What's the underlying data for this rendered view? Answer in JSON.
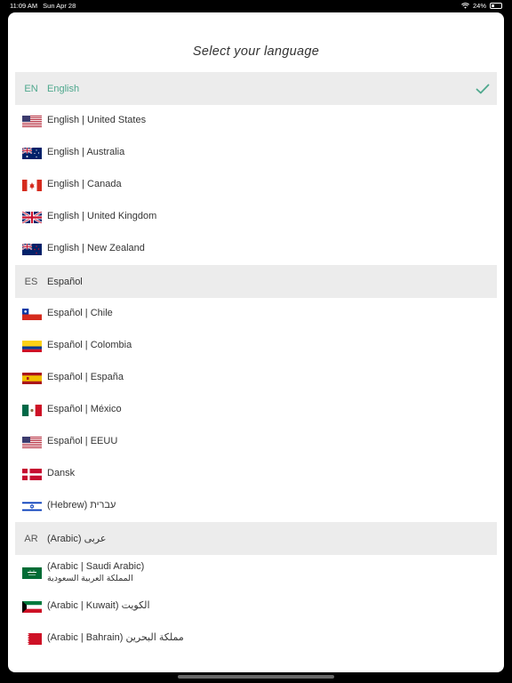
{
  "status": {
    "time": "11:09 AM",
    "date": "Sun Apr 28",
    "battery": "24%",
    "battery_level": 0.24
  },
  "title": "Select your language",
  "colors": {
    "accent": "#4ea88d",
    "header_bg": "#ececec"
  },
  "groups": [
    {
      "code": "EN",
      "label": "English",
      "selected": true,
      "items": [
        {
          "label": "English | United States",
          "flag": "us-flag-icon"
        },
        {
          "label": "English | Australia",
          "flag": "australia-flag-icon"
        },
        {
          "label": "English | Canada",
          "flag": "canada-flag-icon"
        },
        {
          "label": "English | United Kingdom",
          "flag": "uk-flag-icon"
        },
        {
          "label": "English | New Zealand",
          "flag": "new-zealand-flag-icon"
        }
      ]
    },
    {
      "code": "ES",
      "label": "Español",
      "selected": false,
      "items": [
        {
          "label": "Español | Chile",
          "flag": "chile-flag-icon"
        },
        {
          "label": "Español | Colombia",
          "flag": "colombia-flag-icon"
        },
        {
          "label": "Español | España",
          "flag": "spain-flag-icon"
        },
        {
          "label": "Español | México",
          "flag": "mexico-flag-icon"
        },
        {
          "label": "Español | EEUU",
          "flag": "us-flag-icon"
        },
        {
          "label": "Dansk",
          "flag": "denmark-flag-icon"
        },
        {
          "label": "(Hebrew) עברית",
          "flag": "israel-flag-icon"
        }
      ]
    },
    {
      "code": "AR",
      "label": "(Arabic) عربى",
      "selected": false,
      "items": [
        {
          "label": "(Arabic | Saudi Arabic)",
          "sub": "المملكة العربية السعودية",
          "flag": "saudi-arabia-flag-icon"
        },
        {
          "label": "(Arabic | Kuwait) الكويت",
          "flag": "kuwait-flag-icon"
        },
        {
          "label": "(Arabic | Bahrain) مملكة البحرين",
          "flag": "bahrain-flag-icon"
        }
      ]
    }
  ]
}
